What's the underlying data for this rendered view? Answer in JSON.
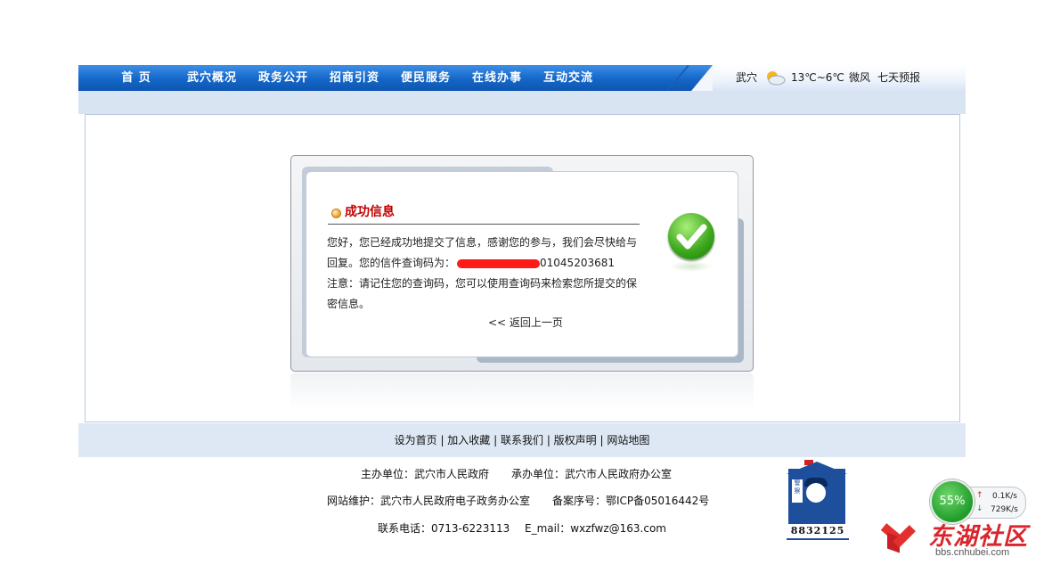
{
  "nav": {
    "items": [
      "首 页",
      "武穴概况",
      "政务公开",
      "招商引资",
      "便民服务",
      "在线办事",
      "互动交流"
    ],
    "weather": {
      "city": "武穴",
      "icon": "partly-cloudy-icon",
      "temp": "13℃~6℃",
      "wind": "微风",
      "forecast_link": "七天预报"
    }
  },
  "dialog": {
    "title": "成功信息",
    "line1": "您好，您已经成功地提交了信息，感谢您的参与，我们会尽快给与",
    "line2_prefix": "回复。您的信件查询码为：",
    "query_code_visible": "01045203681",
    "line3": "注意：请记住您的查询码，您可以使用查询码来检索您所提交的保",
    "line4": "密信息。",
    "back_link": "<< 返回上一页"
  },
  "footer": {
    "links": [
      "设为首页",
      "加入收藏",
      "联系我们",
      "版权声明",
      "网站地图"
    ],
    "sponsor": "主办单位：武穴市人民政府",
    "organizer": "承办单位：武穴市人民政府办公室",
    "maintainer": "网站维护：武穴市人民政府电子政务办公室",
    "icp": "备案序号：鄂ICP备05016442号",
    "phone": "联系电话：0713-6223113",
    "email": "E_mail：wxzfwz@163.com",
    "police_number": "8832125",
    "police_sign": "警察"
  },
  "speed_widget": {
    "percent": "55%",
    "up": "0.1K/s",
    "down": "729K/s"
  },
  "watermark": {
    "brand": "东湖社区",
    "url": "bbs.cnhubei.com"
  },
  "colors": {
    "nav": "#1466c8",
    "title_red": "#c00000",
    "redact": "#ff1a1a",
    "check_green": "#3aa51a"
  }
}
